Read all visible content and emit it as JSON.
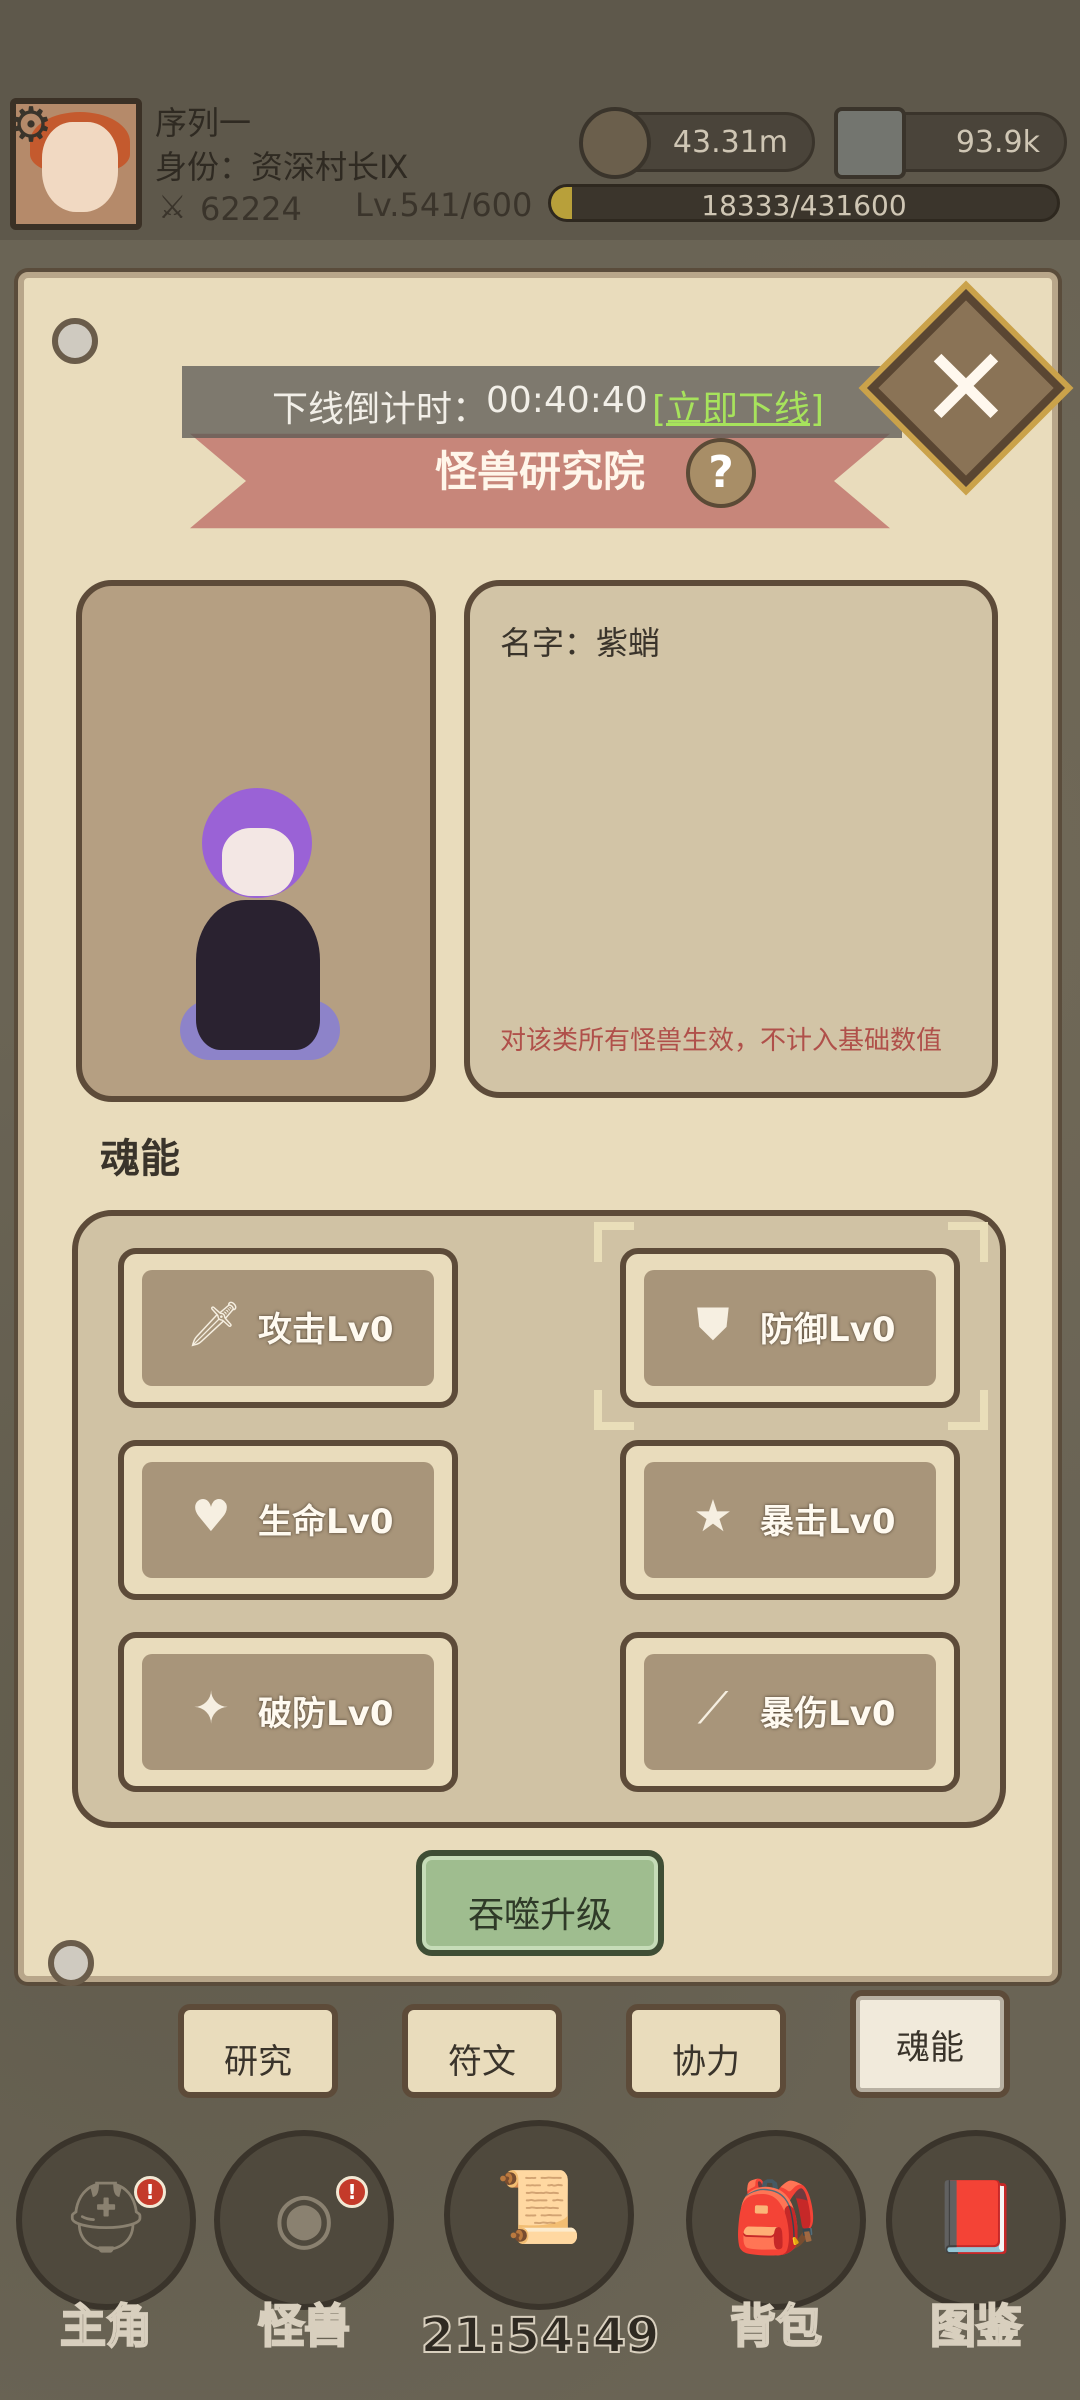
{
  "hud": {
    "player_name": "序列一",
    "player_title": "身份：资深村长Ⅸ",
    "power": "62224",
    "level": "Lv.541/600",
    "coins": "43.31m",
    "stones": "93.9k",
    "exp": "18333/431600",
    "exp_fraction": 0.042
  },
  "countdown": {
    "label": "下线倒计时：",
    "time": "00:40:40",
    "action": "[立即下线]"
  },
  "panel": {
    "title": "怪兽研究院",
    "help": "?",
    "close": "✕"
  },
  "monster": {
    "name": "名字：紫蛸",
    "note": "对该类所有怪兽生效，不计入基础数值"
  },
  "section_title": "魂能",
  "skills": [
    {
      "label": "攻击Lv0",
      "icon": "sword-icon"
    },
    {
      "label": "防御Lv0",
      "icon": "shield-icon"
    },
    {
      "label": "生命Lv0",
      "icon": "heart-icon"
    },
    {
      "label": "暴击Lv0",
      "icon": "star-icon"
    },
    {
      "label": "破防Lv0",
      "icon": "break-icon"
    },
    {
      "label": "暴伤Lv0",
      "icon": "slash-icon"
    }
  ],
  "devour_button": "吞噬升级",
  "tabs": [
    "研究",
    "符文",
    "协力",
    "魂能"
  ],
  "active_tab": "魂能",
  "nav": [
    "主角",
    "怪兽",
    "背包",
    "图鉴"
  ],
  "nav_badges": {
    "hero": "!",
    "monster": "!"
  },
  "clock": "21:54:49"
}
